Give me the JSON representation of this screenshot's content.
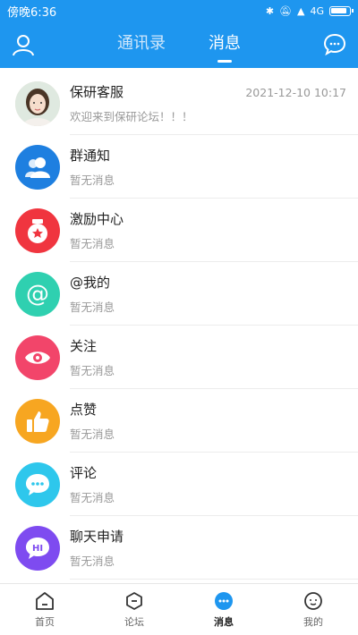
{
  "status": {
    "time": "傍晚6:36",
    "network": "4G"
  },
  "header": {
    "tabs": [
      {
        "label": "通讯录",
        "active": false
      },
      {
        "label": "消息",
        "active": true
      }
    ]
  },
  "messages": [
    {
      "title": "保研客服",
      "subtitle": "欢迎来到保研论坛！！！",
      "time": "2021-12-10 10:17",
      "icon": "user-photo",
      "color": "#e8d8c8"
    },
    {
      "title": "群通知",
      "subtitle": "暂无消息",
      "time": "",
      "icon": "group-icon",
      "color": "#1e7fe0"
    },
    {
      "title": "激励中心",
      "subtitle": "暂无消息",
      "time": "",
      "icon": "badge-icon",
      "color": "#f0353f"
    },
    {
      "title": "@我的",
      "subtitle": "暂无消息",
      "time": "",
      "icon": "at-icon",
      "color": "#2fd0b0"
    },
    {
      "title": "关注",
      "subtitle": "暂无消息",
      "time": "",
      "icon": "eye-icon",
      "color": "#f2456a"
    },
    {
      "title": "点赞",
      "subtitle": "暂无消息",
      "time": "",
      "icon": "thumbs-up-icon",
      "color": "#f7a621"
    },
    {
      "title": "评论",
      "subtitle": "暂无消息",
      "time": "",
      "icon": "comment-icon",
      "color": "#2ec7ec"
    },
    {
      "title": "聊天申请",
      "subtitle": "暂无消息",
      "time": "",
      "icon": "hi-chat-icon",
      "color": "#7e4bf0"
    }
  ],
  "tabbar": [
    {
      "label": "首页",
      "icon": "home-icon",
      "active": false
    },
    {
      "label": "论坛",
      "icon": "forum-icon",
      "active": false
    },
    {
      "label": "消息",
      "icon": "message-icon",
      "active": true
    },
    {
      "label": "我的",
      "icon": "profile-icon",
      "active": false
    }
  ],
  "colors": {
    "primary": "#1e96ef",
    "divider": "#ececec",
    "subtext": "#999999"
  }
}
